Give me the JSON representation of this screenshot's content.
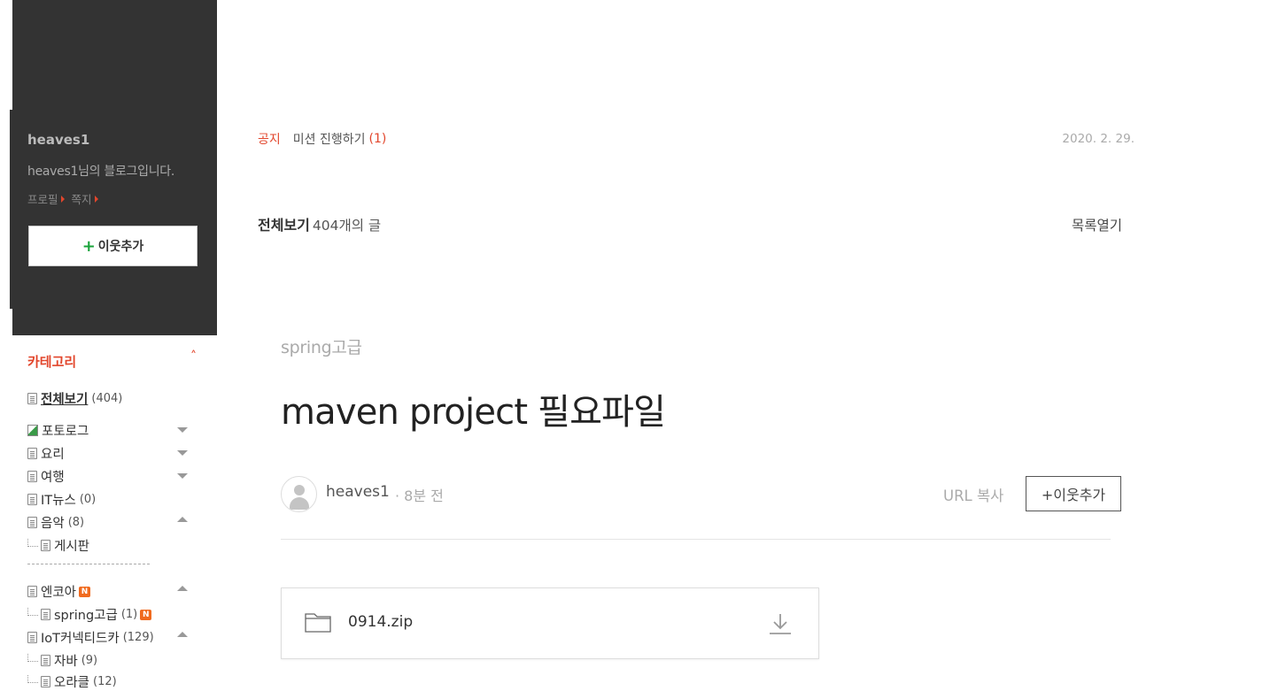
{
  "profile": {
    "blog_name": "heaves1",
    "description": "heaves1님의 블로그입니다.",
    "links": [
      "프로필",
      "쪽지"
    ],
    "add_neighbor": "이웃추가"
  },
  "category": {
    "header": "카테고리",
    "toggle": "˄",
    "items": [
      {
        "label": "전체보기",
        "count": "(404)"
      },
      {
        "label": "포토로그",
        "count": ""
      },
      {
        "label": "요리",
        "count": ""
      },
      {
        "label": "여행",
        "count": ""
      },
      {
        "label": "IT뉴스",
        "count": "(0)"
      },
      {
        "label": "음악",
        "count": "(8)"
      },
      {
        "label": "게시판",
        "count": ""
      },
      {
        "label": "엔코아",
        "count": ""
      },
      {
        "label": "spring고급",
        "count": "(1)"
      },
      {
        "label": "IoT커넥티드카",
        "count": "(129)"
      },
      {
        "label": "자바",
        "count": "(9)"
      },
      {
        "label": "오라클",
        "count": "(12)"
      }
    ],
    "new_badge": "N"
  },
  "notice": {
    "tag": "공지",
    "title": "미션 진행하기",
    "count": "(1)",
    "date": "2020. 2. 29."
  },
  "list_header": {
    "label": "전체보기",
    "sub": "404개의 글",
    "open": "목록열기"
  },
  "post": {
    "category": "spring고급",
    "title": "maven project 필요파일",
    "author": "heaves1",
    "time": "· 8분 전",
    "url_copy": "URL 복사",
    "add_neighbor": "+이웃추가",
    "file_name": "0914.zip"
  }
}
